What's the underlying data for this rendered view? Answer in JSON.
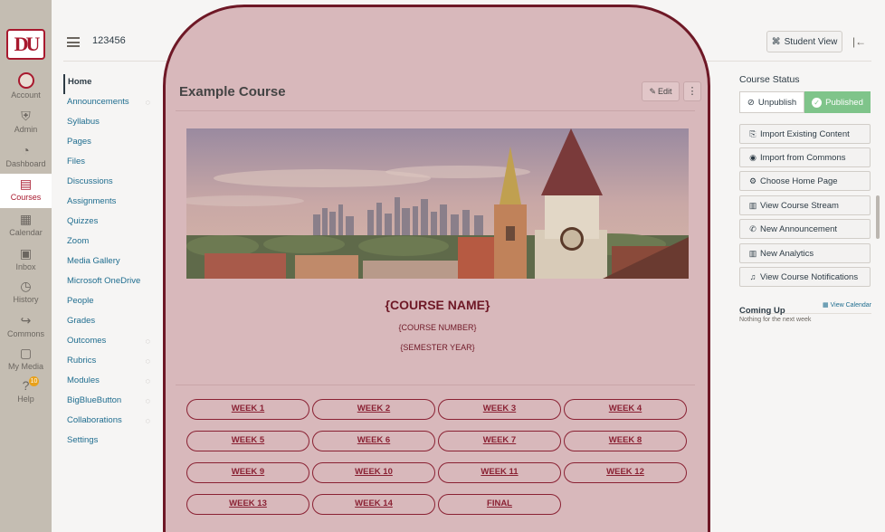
{
  "global_nav": {
    "logo_text": "DU",
    "items": [
      {
        "label": "Account",
        "icon": "avatar"
      },
      {
        "label": "Admin",
        "icon": "shield-icon"
      },
      {
        "label": "Dashboard",
        "icon": "dashboard-icon"
      },
      {
        "label": "Courses",
        "icon": "book-icon"
      },
      {
        "label": "Calendar",
        "icon": "calendar-icon"
      },
      {
        "label": "Inbox",
        "icon": "inbox-icon"
      },
      {
        "label": "History",
        "icon": "clock-icon"
      },
      {
        "label": "Commons",
        "icon": "commons-icon"
      },
      {
        "label": "My Media",
        "icon": "media-icon"
      },
      {
        "label": "Help",
        "icon": "help-icon",
        "badge": "10"
      }
    ],
    "active": "Courses"
  },
  "topbar": {
    "breadcrumb": "123456",
    "student_view_label": "Student View",
    "collapse_icon": "collapse-icon"
  },
  "course_nav": {
    "items": [
      {
        "label": "Home",
        "active": true,
        "hidden": false
      },
      {
        "label": "Announcements",
        "hidden": true
      },
      {
        "label": "Syllabus",
        "hidden": false
      },
      {
        "label": "Pages",
        "hidden": false
      },
      {
        "label": "Files",
        "hidden": false
      },
      {
        "label": "Discussions",
        "hidden": false
      },
      {
        "label": "Assignments",
        "hidden": false
      },
      {
        "label": "Quizzes",
        "hidden": false
      },
      {
        "label": "Zoom",
        "hidden": false
      },
      {
        "label": "Media Gallery",
        "hidden": false
      },
      {
        "label": "Microsoft OneDrive",
        "hidden": false
      },
      {
        "label": "People",
        "hidden": false
      },
      {
        "label": "Grades",
        "hidden": false
      },
      {
        "label": "Outcomes",
        "hidden": true
      },
      {
        "label": "Rubrics",
        "hidden": true
      },
      {
        "label": "Modules",
        "hidden": true
      },
      {
        "label": "BigBlueButton",
        "hidden": true
      },
      {
        "label": "Collaborations",
        "hidden": true
      },
      {
        "label": "Settings",
        "hidden": false
      }
    ]
  },
  "main": {
    "course_title": "Example Course",
    "edit_label": "Edit",
    "more_label": "⋮",
    "course_name": "{COURSE NAME}",
    "course_number": "{COURSE NUMBER}",
    "semester_year": "{SEMESTER YEAR}",
    "weeks": [
      "WEEK 1",
      "WEEK 2",
      "WEEK 3",
      "WEEK 4",
      "WEEK 5",
      "WEEK 6",
      "WEEK 7",
      "WEEK 8",
      "WEEK 9",
      "WEEK 10",
      "WEEK 11",
      "WEEK 12",
      "WEEK 13",
      "WEEK 14",
      "FINAL"
    ]
  },
  "sidebar": {
    "course_status_label": "Course Status",
    "unpublish_label": "Unpublish",
    "published_label": "Published",
    "actions": [
      {
        "label": "Import Existing Content",
        "icon": "import-icon",
        "glyph": "⎘"
      },
      {
        "label": "Import from Commons",
        "icon": "commons-icon",
        "glyph": "◉"
      },
      {
        "label": "Choose Home Page",
        "icon": "home-settings-icon",
        "glyph": "⚙"
      },
      {
        "label": "View Course Stream",
        "icon": "stream-icon",
        "glyph": "▥"
      },
      {
        "label": "New Announcement",
        "icon": "announcement-icon",
        "glyph": "✆"
      },
      {
        "label": "New Analytics",
        "icon": "analytics-icon",
        "glyph": "▥"
      },
      {
        "label": "View Course Notifications",
        "icon": "bell-icon",
        "glyph": "♫"
      }
    ],
    "coming_up_label": "Coming Up",
    "view_calendar_label": "View Calendar",
    "coming_up_empty": "Nothing for the next week"
  },
  "colors": {
    "brand": "#a8192e",
    "overlay": "#d8b8bb",
    "overlay_border": "#6e1826",
    "link": "#1f6d8f",
    "published": "#7fc48a"
  }
}
